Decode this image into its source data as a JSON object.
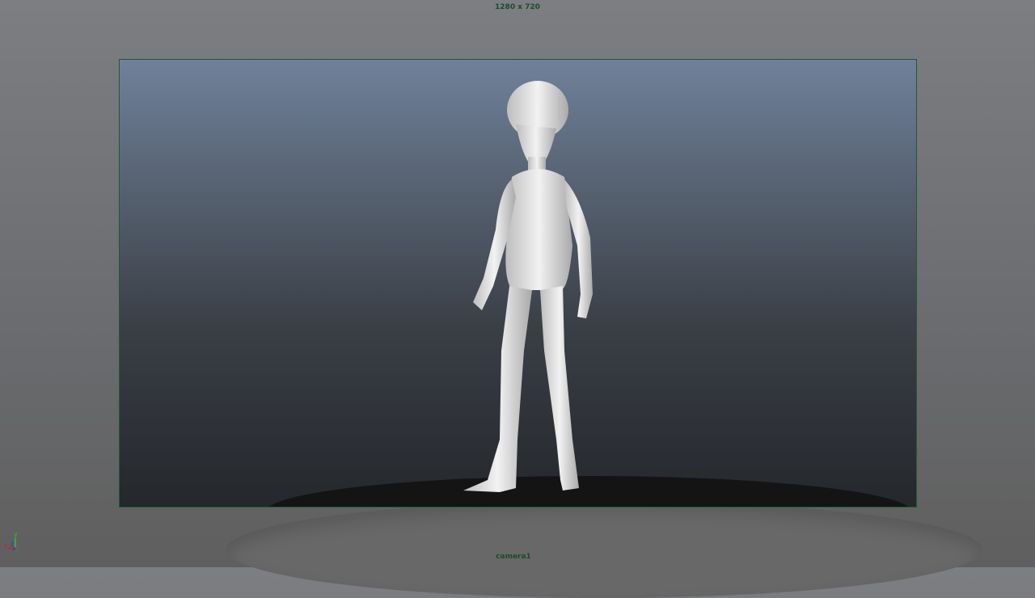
{
  "viewport": {
    "resolution_gate_label": "1280 x 720",
    "camera_label": "camera1",
    "axis_labels": {
      "x": "x",
      "y": "y",
      "z": "z"
    },
    "colors": {
      "gate_border": "#1d5a34",
      "label": "#1c4a2c",
      "x_axis": "#d02020",
      "y_axis": "#30c030",
      "z_axis": "#2040e0"
    }
  }
}
